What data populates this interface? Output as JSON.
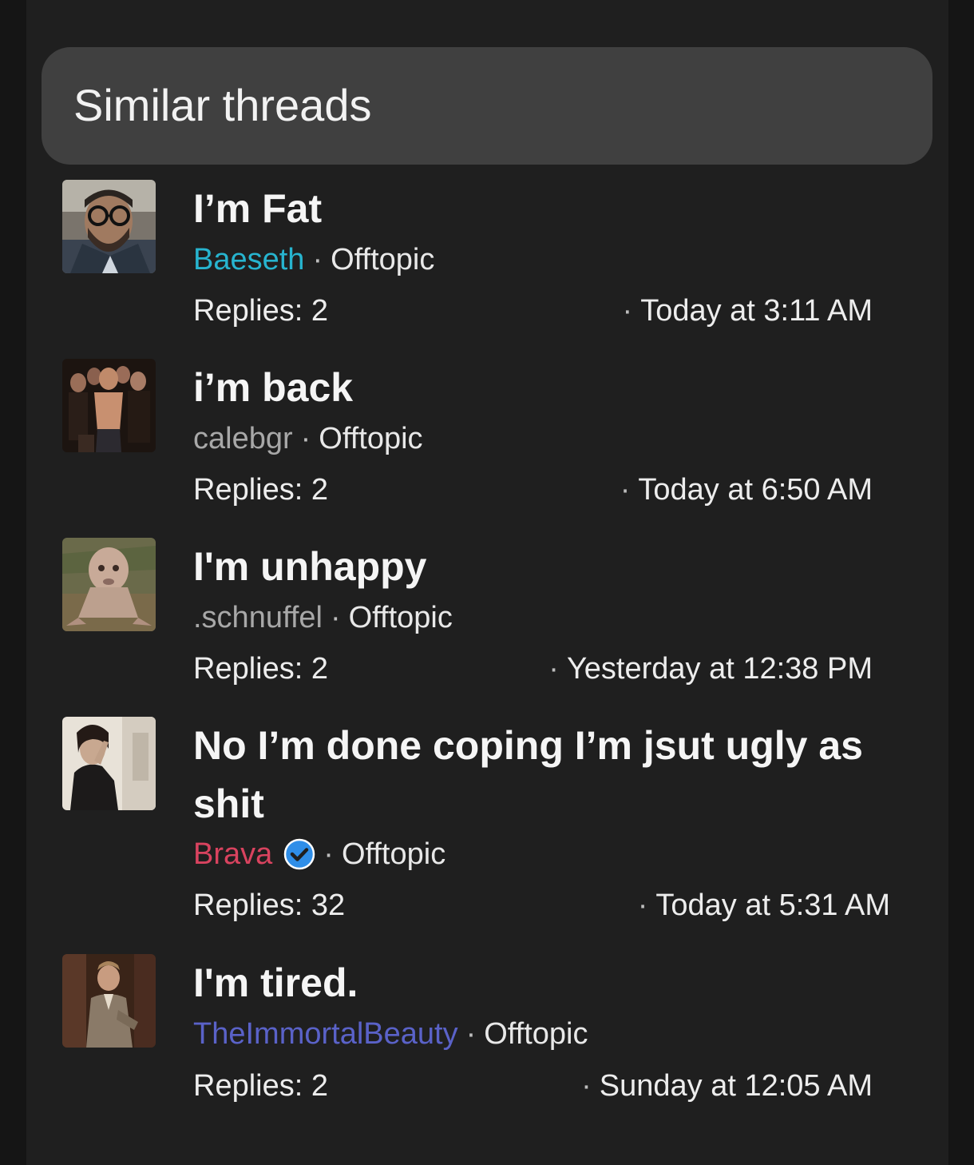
{
  "section": {
    "title": "Similar threads"
  },
  "threads": [
    {
      "title": "I’m Fat",
      "author": "Baeseth",
      "author_color": "#27b4cf",
      "forum": "Offtopic",
      "replies": "Replies: 2",
      "time": "Today at 3:11 AM",
      "verified": false,
      "avatar_icon": "user-avatar-man-glasses"
    },
    {
      "title": "i’m back",
      "author": "calebgr",
      "author_color": "#a8a8a8",
      "forum": "Offtopic",
      "replies": "Replies: 2",
      "time": "Today at 6:50 AM",
      "verified": false,
      "avatar_icon": "user-avatar-group-photo"
    },
    {
      "title": "I'm unhappy",
      "author": ".schnuffel",
      "author_color": "#a8a8a8",
      "forum": "Offtopic",
      "replies": "Replies: 2",
      "time": "Yesterday at 12:38 PM",
      "verified": false,
      "avatar_icon": "user-avatar-creature"
    },
    {
      "title": "No I’m done coping I’m jsut ugly as shit",
      "author": "Brava",
      "author_color": "#d9435f",
      "forum": "Offtopic",
      "replies": "Replies: 32",
      "time": "Today at 5:31 AM",
      "verified": true,
      "avatar_icon": "user-avatar-person-room"
    },
    {
      "title": "I'm tired.",
      "author": "TheImmortalBeauty",
      "author_color": "#5a62c8",
      "forum": "Offtopic",
      "replies": "Replies: 2",
      "time": "Sunday at 12:05 AM",
      "verified": false,
      "avatar_icon": "user-avatar-man-suit"
    }
  ],
  "colors": {
    "panel_bg": "#1f1f1f",
    "header_bg": "#404040",
    "verified_badge": "#2f8ee8"
  }
}
